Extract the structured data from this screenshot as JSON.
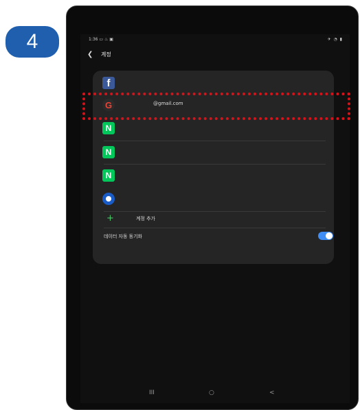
{
  "step": {
    "number": "4"
  },
  "status_bar": {
    "time": "1:36",
    "left_icons": "▭ ♨ ▣",
    "right_icons": "✈ ◔ ▮"
  },
  "header": {
    "back_icon": "back-arrow",
    "title": "계정"
  },
  "accounts": [
    {
      "type": "facebook",
      "icon_glyph": "f",
      "label": ""
    },
    {
      "type": "google",
      "icon_glyph": "G",
      "label": "@gmail.com"
    },
    {
      "type": "naver",
      "icon_glyph": "N",
      "label": ""
    },
    {
      "type": "naver",
      "icon_glyph": "N",
      "label": ""
    },
    {
      "type": "naver",
      "icon_glyph": "N",
      "label": ""
    },
    {
      "type": "samsung",
      "icon_glyph": "",
      "label": ""
    }
  ],
  "add_account": {
    "label": "계정 추가"
  },
  "auto_sync": {
    "label": "데이터 자동 동기화",
    "enabled": true
  },
  "nav": {
    "recent": "III",
    "home": "○",
    "back": "<"
  },
  "colors": {
    "badge": "#1f5fae",
    "highlight": "#d5131a",
    "toggle_on": "#3f8ef5",
    "naver": "#03c75a",
    "facebook": "#3b5998"
  }
}
